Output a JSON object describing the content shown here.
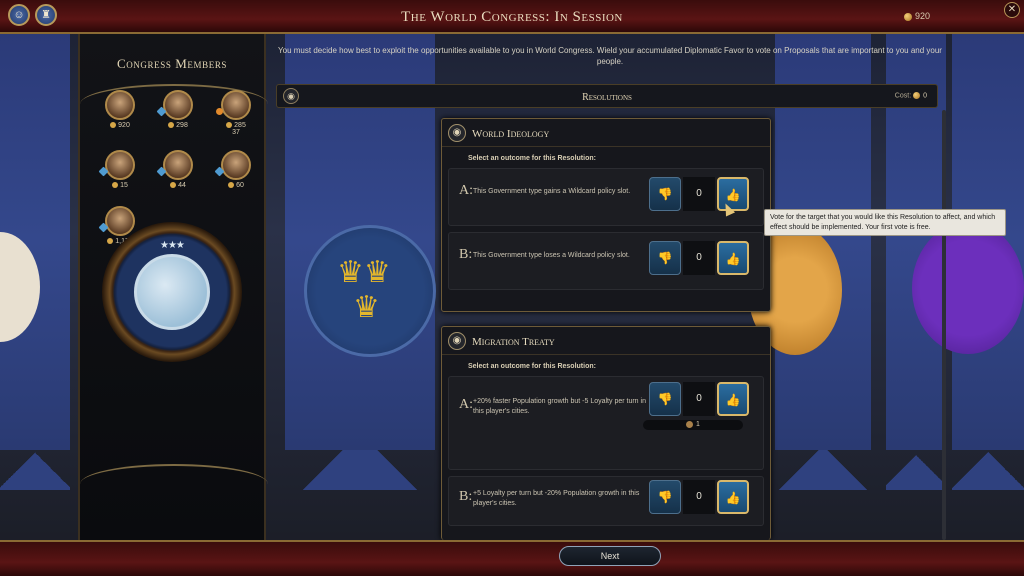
{
  "header": {
    "title": "The World Congress: In Session",
    "favor": "920",
    "close_icon": "close-icon",
    "left_icons": [
      "leader-icon",
      "trophy-icon"
    ]
  },
  "sidebar": {
    "title": "Congress Members",
    "members": [
      {
        "value": "920",
        "indicator": "none"
      },
      {
        "value": "298",
        "indicator": "diplomatic-favor"
      },
      {
        "value": "285",
        "extra": "37",
        "indicator": "orange"
      },
      {
        "value": "15",
        "indicator": "diplomatic-favor"
      },
      {
        "value": "44",
        "indicator": "diplomatic-favor"
      },
      {
        "value": "60",
        "indicator": "diplomatic-favor"
      },
      {
        "value": "1,176",
        "indicator": "diplomatic-favor"
      }
    ]
  },
  "description": "You must decide how best to exploit the opportunities available to you in World Congress. Wield your accumulated Diplomatic Favor to vote on Proposals that are important to you and your people.",
  "resolutions": {
    "header": "Resolutions",
    "cost_label": "Cost:",
    "cost_value": "0",
    "cards": [
      {
        "title": "World Ideology",
        "subtitle": "Select an outcome for this Resolution:",
        "outcomes": [
          {
            "letter": "A:",
            "text": "This Government type gains a Wildcard policy slot.",
            "votes": "0"
          },
          {
            "letter": "B:",
            "text": "This Government type loses a Wildcard policy slot.",
            "votes": "0"
          }
        ]
      },
      {
        "title": "Migration Treaty",
        "subtitle": "Select an outcome for this Resolution:",
        "outcomes": [
          {
            "letter": "A:",
            "text": "+20% faster Population growth but -5 Loyalty per turn in this player's cities.",
            "votes": "0",
            "target": "1"
          },
          {
            "letter": "B:",
            "text": "+5 Loyalty per turn but -20% Population growth in this player's cities.",
            "votes": "0"
          }
        ]
      }
    ]
  },
  "tooltip": "Vote for the target that you would like this Resolution to affect, and which effect should be implemented. Your first vote is free.",
  "footer": {
    "next_label": "Next"
  },
  "colors": {
    "accent": "#b8975a",
    "banner": "#2f417f",
    "vote_up": "#2b6da0"
  }
}
